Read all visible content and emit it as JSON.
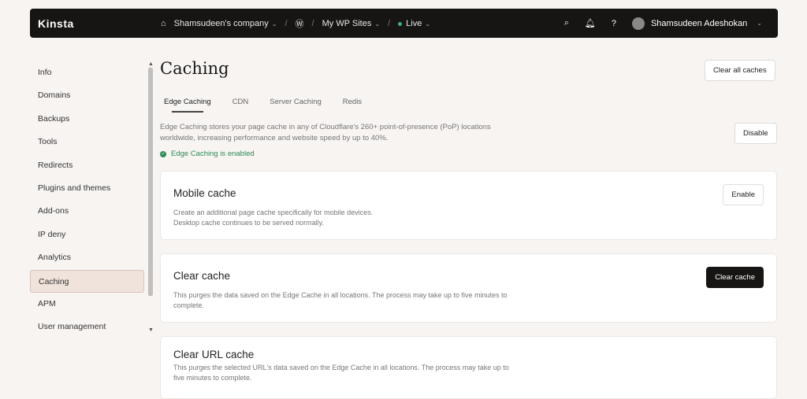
{
  "topbar": {
    "logo": "Kinsta",
    "company": "Shamsudeen's company",
    "sites": "My WP Sites",
    "env": "Live",
    "user": "Shamsudeen Adeshokan"
  },
  "sidebar": {
    "items": [
      "Info",
      "Domains",
      "Backups",
      "Tools",
      "Redirects",
      "Plugins and themes",
      "Add-ons",
      "IP deny",
      "Analytics",
      "Caching",
      "APM",
      "User management"
    ]
  },
  "page": {
    "title": "Caching",
    "clear_all": "Clear all caches",
    "tabs": [
      "Edge Caching",
      "CDN",
      "Server Caching",
      "Redis"
    ],
    "desc": "Edge Caching stores your page cache in any of Cloudflare's 260+ point-of-presence (PoP) locations worldwide, increasing performance and website speed by up to 40%.",
    "disable": "Disable",
    "status": "Edge Caching is enabled"
  },
  "cards": [
    {
      "title": "Mobile cache",
      "desc1": "Create an additional page cache specifically for mobile devices.",
      "desc2": "Desktop cache continues to be served normally.",
      "button": "Enable"
    },
    {
      "title": "Clear cache",
      "desc": "This purges the data saved on the Edge Cache in all locations. The process may take up to five minutes to complete.",
      "button": "Clear cache"
    },
    {
      "title": "Clear URL cache",
      "desc": "This purges the selected URL's data saved on the Edge Cache in all locations. The process may take up to five minutes to complete."
    }
  ]
}
